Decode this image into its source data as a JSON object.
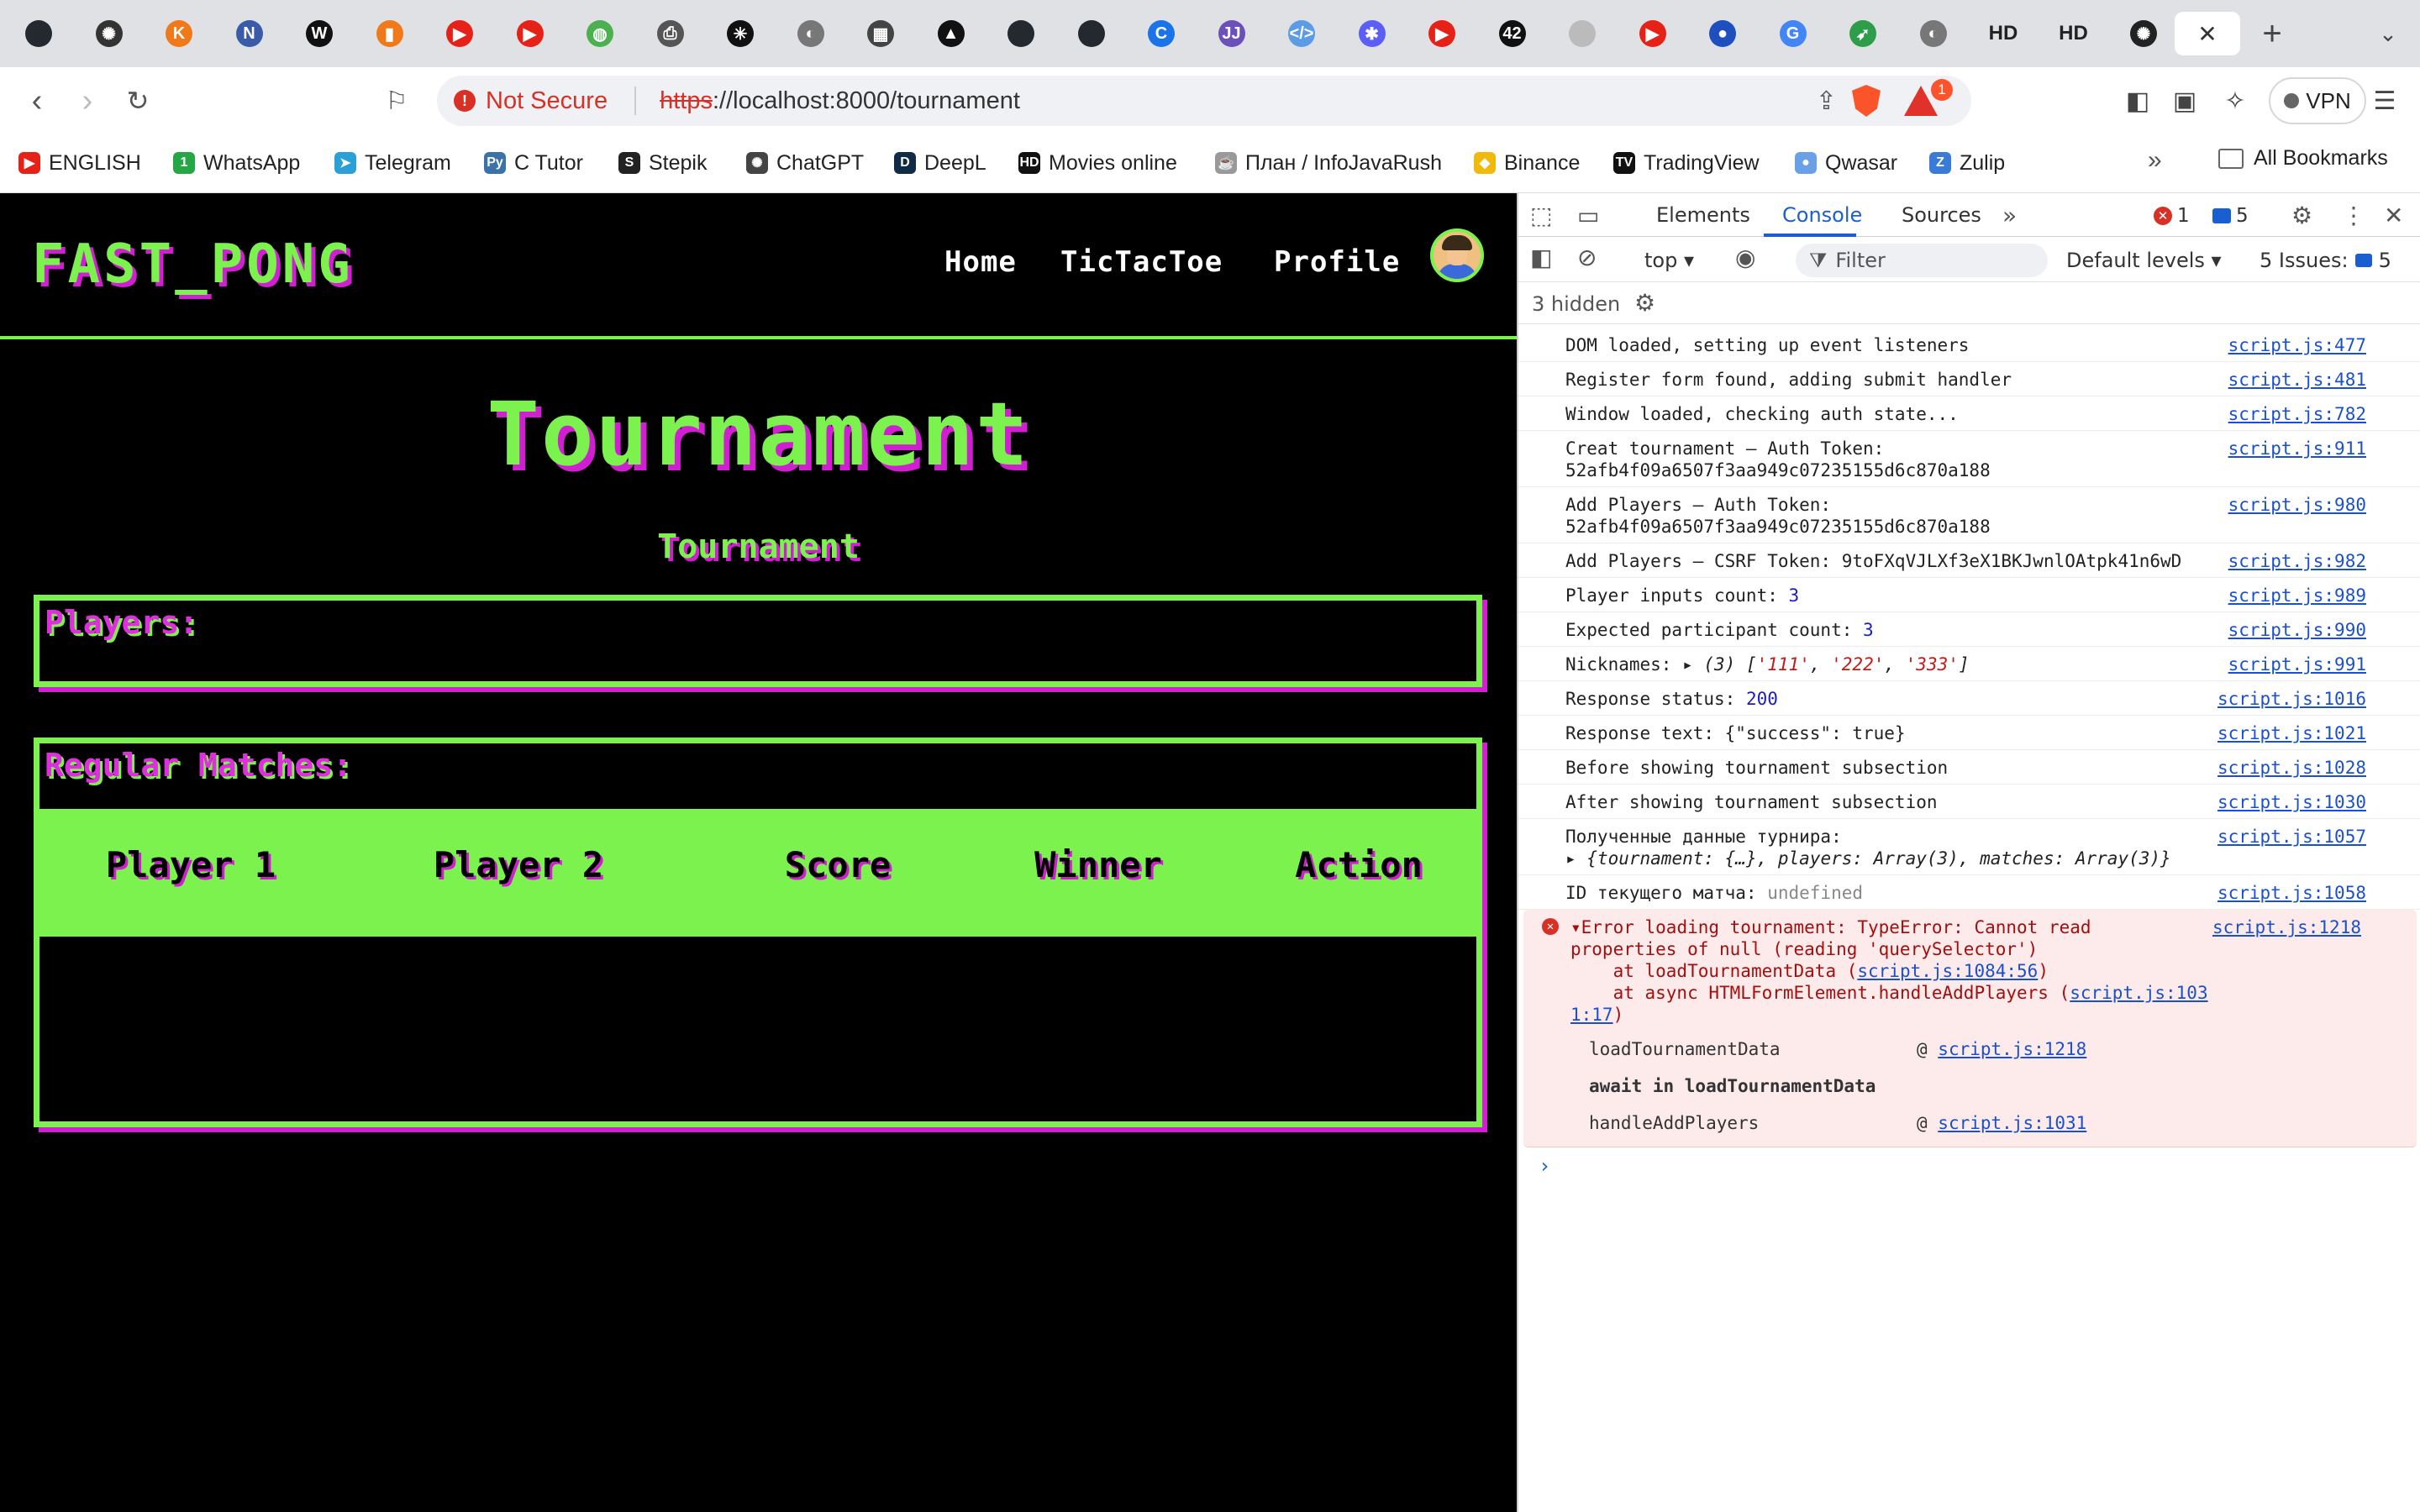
{
  "browser": {
    "tabs": [
      {
        "icon": "github-icon",
        "glyph": "",
        "color": "#24292f"
      },
      {
        "icon": "chatgpt-icon",
        "glyph": "✺",
        "color": "#333"
      },
      {
        "icon": "k-icon",
        "glyph": "K",
        "color": "#f07a1a"
      },
      {
        "icon": "notion-icon",
        "glyph": "N",
        "color": "#3b5ba8"
      },
      {
        "icon": "wwr-icon",
        "glyph": "W",
        "color": "#111"
      },
      {
        "icon": "bar-chart-icon",
        "glyph": "▮",
        "color": "#f07a1a"
      },
      {
        "icon": "youtube-icon",
        "glyph": "▶",
        "color": "#e62117"
      },
      {
        "icon": "youtube-icon",
        "glyph": "▶",
        "color": "#e62117"
      },
      {
        "icon": "green-circle-icon",
        "glyph": "◍",
        "color": "#4caf50"
      },
      {
        "icon": "printer-icon",
        "glyph": "⎙",
        "color": "#555"
      },
      {
        "icon": "star-burst-icon",
        "glyph": "✳",
        "color": "#111"
      },
      {
        "icon": "globe-icon",
        "glyph": "◐",
        "color": "#777"
      },
      {
        "icon": "book-icon",
        "glyph": "▦",
        "color": "#444"
      },
      {
        "icon": "triangle-icon",
        "glyph": "▲",
        "color": "#111"
      },
      {
        "icon": "github-icon",
        "glyph": "",
        "color": "#24292f"
      },
      {
        "icon": "github-icon",
        "glyph": "",
        "color": "#24292f"
      },
      {
        "icon": "c-icon",
        "glyph": "C",
        "color": "#1a73e8"
      },
      {
        "icon": "jetbrains-icon",
        "glyph": "JJ",
        "color": "#6b4fbb"
      },
      {
        "icon": "code-icon",
        "glyph": "</>",
        "color": "#5c9be6"
      },
      {
        "icon": "asterisk-icon",
        "glyph": "✱",
        "color": "#5b5ff5"
      },
      {
        "icon": "youtube-icon",
        "glyph": "▶",
        "color": "#e62117"
      },
      {
        "icon": "42-icon",
        "glyph": "42",
        "color": "#111"
      },
      {
        "icon": "github-icon",
        "glyph": "",
        "color": "#bbb"
      },
      {
        "icon": "youtube-icon",
        "glyph": "▶",
        "color": "#e62117"
      },
      {
        "icon": "blue-circle-icon",
        "glyph": "●",
        "color": "#1f4fbf"
      },
      {
        "icon": "google-icon",
        "glyph": "G",
        "color": "#4285f4"
      },
      {
        "icon": "cursor-icon",
        "glyph": "➶",
        "color": "#2e9d4a"
      },
      {
        "icon": "globe-icon",
        "glyph": "◐",
        "color": "#777"
      }
    ],
    "hd_tabs": [
      "HD",
      "HD"
    ],
    "active_tab_icon": "chatgpt-icon",
    "close_glyph": "✕",
    "new_tab_glyph": "+",
    "tab_menu_glyph": "⌄",
    "not_secure_label": "Not Secure",
    "url_scheme": "https",
    "url_rest": "://localhost:8000/tournament",
    "rewards_count": "1",
    "vpn_label": "VPN",
    "bookmarks": [
      {
        "label": "ENGLISH",
        "icon": "youtube-icon",
        "glyph": "▶",
        "color": "#e62117"
      },
      {
        "label": "WhatsApp",
        "icon": "whatsapp-icon",
        "glyph": "1",
        "color": "#25a745"
      },
      {
        "label": "Telegram",
        "icon": "telegram-icon",
        "glyph": "➤",
        "color": "#2a9fd8"
      },
      {
        "label": "C Tutor",
        "icon": "python-icon",
        "glyph": "Py",
        "color": "#3b73a8"
      },
      {
        "label": "Stepik",
        "icon": "stepik-icon",
        "glyph": "S",
        "color": "#222"
      },
      {
        "label": "ChatGPT",
        "icon": "chatgpt-icon",
        "glyph": "✺",
        "color": "#444"
      },
      {
        "label": "DeepL",
        "icon": "deepl-icon",
        "glyph": "D",
        "color": "#0f2b46"
      },
      {
        "label": "Movies online",
        "icon": "hd-icon",
        "glyph": "HD",
        "color": "#111"
      },
      {
        "label": "План / InfoJavaRush",
        "icon": "coffee-icon",
        "glyph": "☕",
        "color": "#999"
      },
      {
        "label": "Binance",
        "icon": "binance-icon",
        "glyph": "◆",
        "color": "#f0b90b"
      },
      {
        "label": "TradingView",
        "icon": "tradingview-icon",
        "glyph": "TV",
        "color": "#111"
      },
      {
        "label": "Qwasar",
        "icon": "qwasar-icon",
        "glyph": "●",
        "color": "#6aa0e8"
      },
      {
        "label": "Zulip",
        "icon": "zulip-icon",
        "glyph": "Z",
        "color": "#3b7bd8"
      }
    ],
    "all_bookmarks_label": "All Bookmarks"
  },
  "site": {
    "logo": "FAST_PONG",
    "nav": [
      "Home",
      "TicTacToe",
      "Profile"
    ],
    "title": "Tournament",
    "subtitle": "Tournament",
    "players_label": "Players:",
    "matches_label": "Regular Matches:",
    "columns": [
      "Player 1",
      "Player 2",
      "Score",
      "Winner",
      "Action"
    ],
    "colors": {
      "green": "#7cf24f",
      "magenta": "#d01fd0",
      "background": "#000000"
    }
  },
  "devtools": {
    "tabs": [
      "Elements",
      "Console",
      "Sources"
    ],
    "active_tab": "Console",
    "error_count": "1",
    "message_count": "5",
    "context": "top",
    "filter_placeholder": "Filter",
    "levels": "Default levels",
    "issues_label": "5 Issues:",
    "issues_count": "5",
    "hidden_label": "3 hidden",
    "logs": [
      {
        "text": "DOM loaded, setting up event listeners",
        "src": "script.js:477"
      },
      {
        "text": "Register form found, adding submit handler",
        "src": "script.js:481"
      },
      {
        "text": "Window loaded, checking auth state...",
        "src": "script.js:782"
      },
      {
        "text": "Creat tournament – Auth Token:\n52afb4f09a6507f3aa949c07235155d6c870a188",
        "src": "script.js:911"
      },
      {
        "text": "Add Players – Auth Token:\n52afb4f09a6507f3aa949c07235155d6c870a188",
        "src": "script.js:980"
      },
      {
        "text": "Add Players – CSRF Token: 9toFXqVJLXf3eX1BKJwnlOAtpk41n6wD",
        "src": "script.js:982"
      },
      {
        "text": "Player inputs count: ",
        "num": "3",
        "src": "script.js:989"
      },
      {
        "text": "Expected participant count: ",
        "num": "3",
        "src": "script.js:990"
      }
    ],
    "nicknames": {
      "prefix": "Nicknames: ",
      "count": "(3)",
      "values": [
        "'111'",
        "'222'",
        "'333'"
      ],
      "src": "script.js:991"
    },
    "logs2": [
      {
        "text": "Response status: ",
        "num": "200",
        "src": "script.js:1016"
      },
      {
        "text": "Response text: {\"success\": true}",
        "src": "script.js:1021"
      },
      {
        "text": "Before showing tournament subsection",
        "src": "script.js:1028"
      },
      {
        "text": "After showing tournament subsection",
        "src": "script.js:1030"
      }
    ],
    "tournament_data": {
      "text": "Полученные данные турнира:",
      "object": "{tournament: {…}, players: Array(3), matches: Array(3)}",
      "src": "script.js:1057"
    },
    "match_id": {
      "text": "ID текущего матча: ",
      "value": "undefined",
      "src": "script.js:1058"
    },
    "error": {
      "text": "Error loading tournament: TypeError: Cannot read\nproperties of null (reading 'querySelector')",
      "line1_prefix": "    at loadTournamentData (",
      "line1_link": "script.js:1084:56",
      "line2_prefix": "    at async HTMLFormElement.handleAddPlayers (",
      "line2_link": "script.js:1031:17",
      "src": "script.js:1218",
      "stack": [
        {
          "fn": "loadTournamentData",
          "at": "@ ",
          "link": "script.js:1218"
        },
        {
          "fn": "await in loadTournamentData",
          "at": "",
          "link": ""
        },
        {
          "fn": "handleAddPlayers",
          "at": "@ ",
          "link": "script.js:1031"
        }
      ]
    }
  }
}
